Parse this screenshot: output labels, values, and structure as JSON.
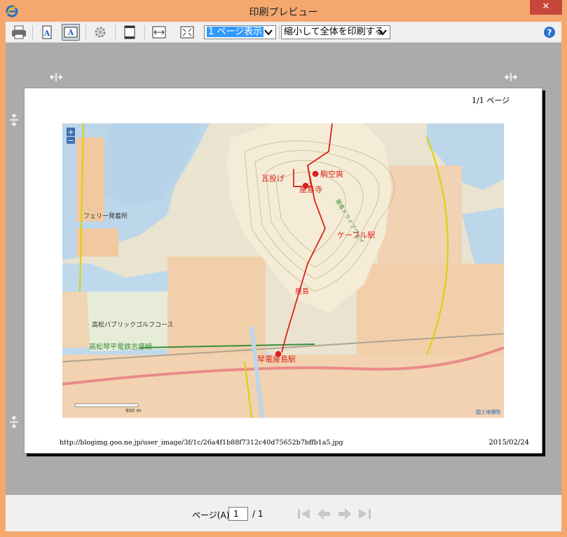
{
  "window": {
    "title": "印刷プレビュー",
    "close_glyph": "✕"
  },
  "toolbar": {
    "view_mode_selected": "1 ページ表示",
    "scale_selected": "縮小して全体を印刷する"
  },
  "page": {
    "page_number": "1/1 ページ",
    "url": "http://blogimg.goo.ne.jp/user_image/3f/1c/26a4f1b88f7312c40d75652b7bffb1a5.jpg",
    "date": "2015/02/24"
  },
  "map": {
    "labels": {
      "shrine_east": "駒空爽",
      "shrine_west": "瓦投げ",
      "temple": "屋島寺",
      "cable": "ケーブル駅",
      "station": "琴電屋島駅",
      "railway": "高松琴平電鉄志度線",
      "course": "高松パブリックゴルフコース",
      "ferry": "フェリー発着所",
      "scale": "900 m",
      "credit": "国土地理院",
      "station_label_small": "屋島",
      "park": "屋島ドライブウェイ"
    }
  },
  "footer": {
    "page_label": "ページ(A)",
    "current_page": "1",
    "total_pages": "/ 1"
  },
  "colors": {
    "frame": "#f5a86e",
    "close": "#c7463b",
    "route": "#d9241b"
  }
}
